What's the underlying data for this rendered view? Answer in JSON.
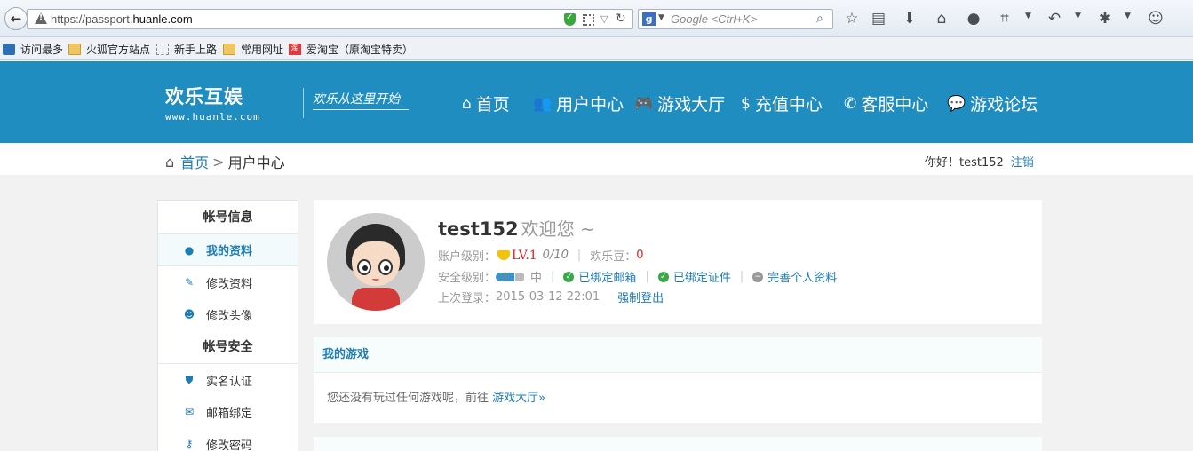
{
  "browser": {
    "url_prefix": "https://passport.",
    "url_domain": "huanle.com",
    "search_engine": "g",
    "search_placeholder": "Google <Ctrl+K>"
  },
  "bookmarks": [
    {
      "label": "访问最多",
      "icon": "star-icon"
    },
    {
      "label": "火狐官方站点",
      "icon": "folder-icon"
    },
    {
      "label": "新手上路",
      "icon": "page-icon"
    },
    {
      "label": "常用网址",
      "icon": "folder-icon"
    },
    {
      "label": "爱淘宝（原淘宝特卖）",
      "icon": "taobao-icon"
    }
  ],
  "header": {
    "logo_text": "欢乐互娱",
    "logo_url": "www.huanle.com",
    "slogan": "欢乐从这里开始",
    "nav": [
      {
        "label": "首页",
        "icon": "home-icon"
      },
      {
        "label": "用户中心",
        "icon": "users-icon"
      },
      {
        "label": "游戏大厅",
        "icon": "gamepad-icon"
      },
      {
        "label": "充值中心",
        "icon": "money-bag-icon"
      },
      {
        "label": "客服中心",
        "icon": "phone-icon"
      },
      {
        "label": "游戏论坛",
        "icon": "chat-icon"
      }
    ]
  },
  "breadcrumb": {
    "home": "首页",
    "separator": ">",
    "current": "用户中心"
  },
  "user_bar": {
    "greeting": "你好！test152",
    "logout": "注销"
  },
  "sidebar": {
    "account_title": "帐号信息",
    "account_items": [
      {
        "label": "我的资料",
        "icon": "user-icon",
        "active": true
      },
      {
        "label": "修改资料",
        "icon": "pencil-icon",
        "active": false
      },
      {
        "label": "修改头像",
        "icon": "face-icon",
        "active": false
      }
    ],
    "security_title": "帐号安全",
    "security_items": [
      {
        "label": "实名认证",
        "icon": "shield-icon"
      },
      {
        "label": "邮箱绑定",
        "icon": "envelope-icon"
      },
      {
        "label": "修改密码",
        "icon": "key-icon"
      }
    ]
  },
  "profile": {
    "username": "test152",
    "welcome": "欢迎您 ~",
    "level_label": "账户级别：",
    "level": "LV.1",
    "level_exp": "0/10",
    "bean_label": "欢乐豆：",
    "bean_value": "0",
    "security_label": "安全级别：",
    "security_level": "中",
    "security_level_fraction": 0.67,
    "email_bound": "已绑定邮箱",
    "id_bound": "已绑定证件",
    "complete_profile": "完善个人资料",
    "last_login_label": "上次登录：",
    "last_login": "2015-03-12 22:01",
    "force_logout": "强制登出"
  },
  "my_games": {
    "title": "我的游戏",
    "empty_text": "您还没有玩过任何游戏呢，前往",
    "link": "游戏大厅»"
  },
  "colors": {
    "brand_blue": "#1f8dc0",
    "link_blue": "#1f7cb0",
    "accent_red": "#dd2222"
  }
}
